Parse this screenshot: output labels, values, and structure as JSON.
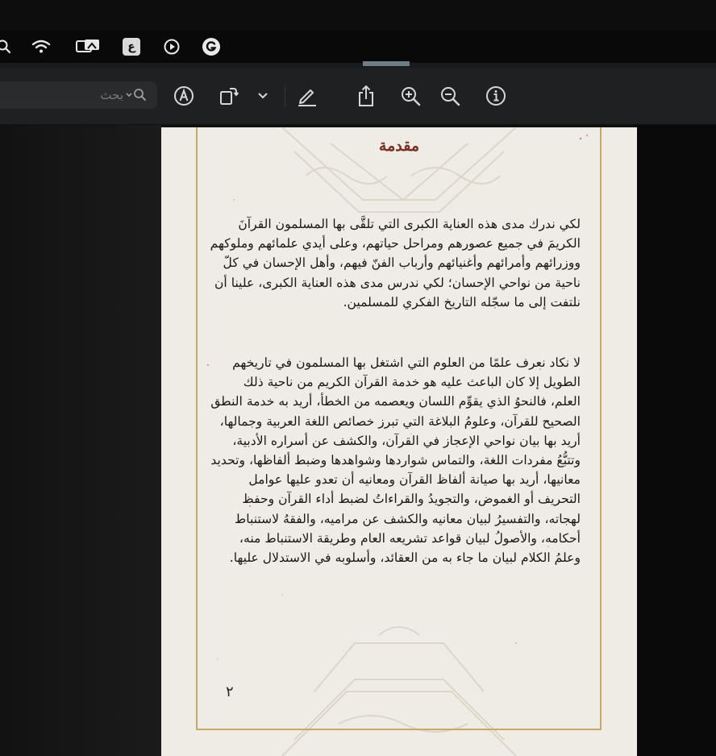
{
  "menubar": {
    "icons": [
      "search-icon",
      "wifi-icon",
      "screen-mirroring-icon",
      "keyboard-input-icon",
      "media-play-icon",
      "grammarly-icon"
    ],
    "input_badge": "ع"
  },
  "toolbar": {
    "search_placeholder": "بحث",
    "buttons": [
      "markup-icon",
      "rotate-icon",
      "chevron-down-icon",
      "highlight-pen-icon",
      "share-icon",
      "zoom-in-icon",
      "zoom-out-icon",
      "info-icon"
    ]
  },
  "document": {
    "title": "مقدمة",
    "paragraphs": [
      "لكي ندرك مدى هذه العناية الكبرى التي تلقَّى بها المسلمون القرآنَ الكريمَ في جميع عصورهم ومراحل حياتهم، وعلى أيدي علمائهم وملوكهم ووزرائهم وأمرائهم وأغنيائهم وأرباب الفنّ فيهم، وأهل الإحسان في كلّ ناحية من نواحي الإحسان؛ لكي ندرس مدى هذه العناية الكبرى، علينا أن نلتفت إلى ما سجّله التاريخ الفكري للمسلمين.",
      "لا نكاد نعرف علمًا من العلوم التي اشتغل بها المسلمون في تاريخهم الطويل إلا كان الباعث عليه هو خدمة القرآن الكريم من ناحية ذلك العلم، فالنحوُ الذي يقوِّم اللسان ويعصمه من الخطأ، أريد به خدمة النطق الصحيح للقرآن، وعلومُ البلاغة التي تبرز خصائص اللغة العربية وجمالها، أريد بها بيان نواحي الإعجاز في القرآن، والكشف عن أسراره الأدبية، وتتبُّعُ مفردات اللغة، والتماس شواردها وشواهدها وضبط ألفاظها، وتحديد معانيها، أريد بها صيانة ألفاظ القرآن ومعانيه أن تعدو عليها عوامل التحريف أو الغموض، والتجويدُ والقراءاتُ لضبط أداء القرآن وحفظ لهجاته، والتفسيرُ لبيان معانيه والكشف عن مراميه، والفقهُ لاستنباط أحكامه، والأصولُ لبيان قواعد تشريعه العام وطريقة الاستنباط منه، وعلمُ الكلام لبيان ما جاء به من العقائد، وأسلوبه في الاستدلال عليها."
    ],
    "page_number": "٢"
  },
  "colors": {
    "page_background": "#efece6",
    "title_color": "#7a2f22",
    "frame_gold": "#c6aa6a",
    "toolbar_bg": "#1f2022"
  }
}
